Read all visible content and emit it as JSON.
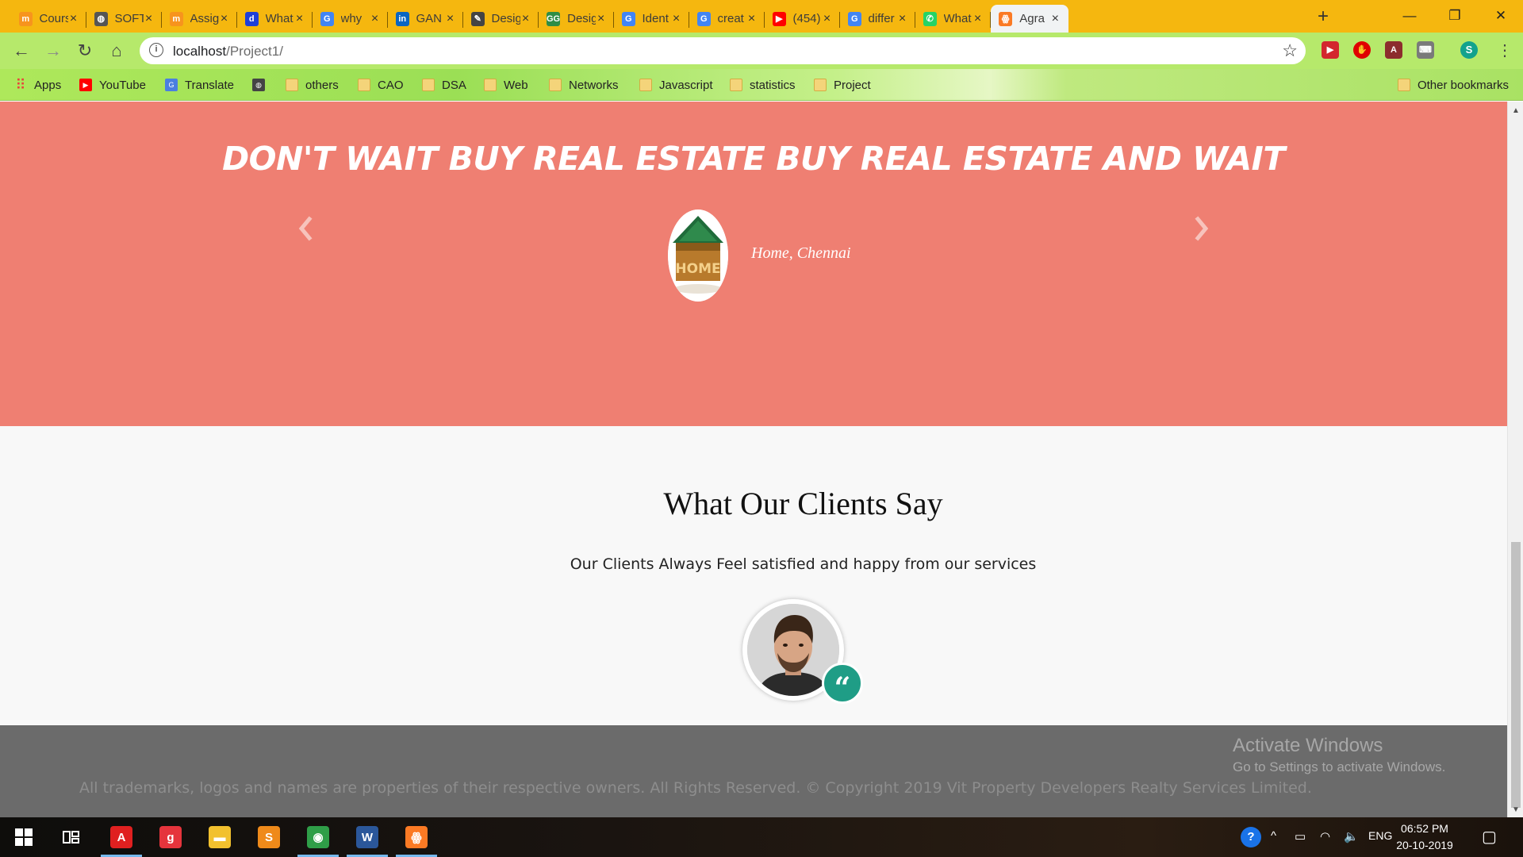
{
  "browser": {
    "tabs": [
      {
        "title": "Cours",
        "favicon": "moodle-icon",
        "color": "#f7941d"
      },
      {
        "title": "SOFT",
        "favicon": "globe-icon",
        "color": "#555555"
      },
      {
        "title": "Assig",
        "favicon": "moodle-icon",
        "color": "#f7941d"
      },
      {
        "title": "What",
        "favicon": "d-icon",
        "color": "#1e3fd9"
      },
      {
        "title": "why",
        "favicon": "google-icon",
        "color": "#4285f4"
      },
      {
        "title": "GAN",
        "favicon": "linkedin-icon",
        "color": "#0a66c2"
      },
      {
        "title": "Desig",
        "favicon": "feather-icon",
        "color": "#444444"
      },
      {
        "title": "Desig",
        "favicon": "gfg-icon",
        "color": "#2f8d46"
      },
      {
        "title": "Ident",
        "favicon": "google-icon",
        "color": "#4285f4"
      },
      {
        "title": "creat",
        "favicon": "google-icon",
        "color": "#4285f4"
      },
      {
        "title": "(454)",
        "favicon": "youtube-icon",
        "color": "#ff0000"
      },
      {
        "title": "differ",
        "favicon": "google-icon",
        "color": "#4285f4"
      },
      {
        "title": "What",
        "favicon": "whatsapp-icon",
        "color": "#25d366"
      },
      {
        "title": "Agra",
        "favicon": "xampp-icon",
        "color": "#fb7a24",
        "active": true
      }
    ],
    "new_tab": "+",
    "window_controls": {
      "minimize": "—",
      "restore": "❐",
      "close": "✕"
    },
    "nav": {
      "back": "←",
      "forward": "→",
      "reload": "↻",
      "home": "⌂"
    },
    "address": {
      "host": "localhost",
      "path": "/Project1/"
    },
    "profile_initial": "S",
    "bookmarks": [
      {
        "label": "Apps",
        "icon": "apps-grid-icon"
      },
      {
        "label": "YouTube",
        "icon": "youtube-icon"
      },
      {
        "label": "Translate",
        "icon": "translate-icon"
      },
      {
        "label": "",
        "icon": "globe-icon"
      },
      {
        "label": "others",
        "icon": "folder-icon"
      },
      {
        "label": "CAO",
        "icon": "folder-icon"
      },
      {
        "label": "DSA",
        "icon": "folder-icon"
      },
      {
        "label": "Web",
        "icon": "folder-icon"
      },
      {
        "label": "Networks",
        "icon": "folder-icon"
      },
      {
        "label": "Javascript",
        "icon": "folder-icon"
      },
      {
        "label": "statistics",
        "icon": "folder-icon"
      },
      {
        "label": "Project",
        "icon": "folder-icon"
      }
    ],
    "other_bookmarks": "Other bookmarks"
  },
  "page": {
    "hero": {
      "title": "DON'T WAIT BUY REAL ESTATE BUY REAL ESTATE AND WAIT",
      "caption": "Home, Chennai",
      "image_text": "HOME",
      "background": "#ef7f72"
    },
    "clients": {
      "title": "What Our Clients Say",
      "subtitle": "Our Clients Always Feel satisfied and happy from our services",
      "quote_mark": "“"
    },
    "footer": {
      "text": "All trademarks, logos and names are properties of their respective owners. All Rights Reserved. © Copyright 2019 Vit Property Developers Realty Services Limited.",
      "watermark_title": "Activate Windows",
      "watermark_subtitle": "Go to Settings to activate Windows."
    }
  },
  "taskbar": {
    "apps": [
      {
        "name": "acrobat",
        "glyph": "A",
        "color": "#e02020",
        "open": true
      },
      {
        "name": "grammarly",
        "glyph": "g",
        "color": "#e5343c",
        "open": false
      },
      {
        "name": "file-explorer",
        "glyph": "▬",
        "color": "#f2c12e",
        "open": false
      },
      {
        "name": "sublime",
        "glyph": "S",
        "color": "#ef8a1a",
        "open": false
      },
      {
        "name": "chrome",
        "glyph": "◉",
        "color": "#2f9e48",
        "open": true
      },
      {
        "name": "word",
        "glyph": "W",
        "color": "#2b579a",
        "open": true
      },
      {
        "name": "xampp",
        "glyph": "ꙮ",
        "color": "#fb7a24",
        "open": true
      }
    ],
    "language": "ENG",
    "time": "06:52 PM",
    "date": "20-10-2019"
  }
}
